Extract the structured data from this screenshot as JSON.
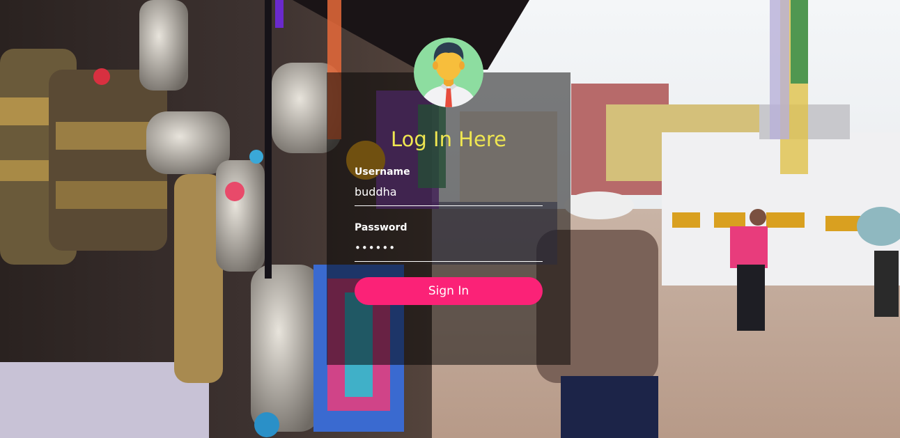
{
  "login": {
    "title": "Log In Here",
    "username_label": "Username",
    "username_value": "buddha",
    "password_label": "Password",
    "password_value": "••••••",
    "submit_label": "Sign In"
  },
  "colors": {
    "title": "#efe651",
    "button": "#fb2277",
    "avatar_bg": "#8ddda0",
    "overlay": "rgba(0,0,0,0.5)"
  },
  "icons": {
    "avatar": "user-avatar-icon"
  }
}
